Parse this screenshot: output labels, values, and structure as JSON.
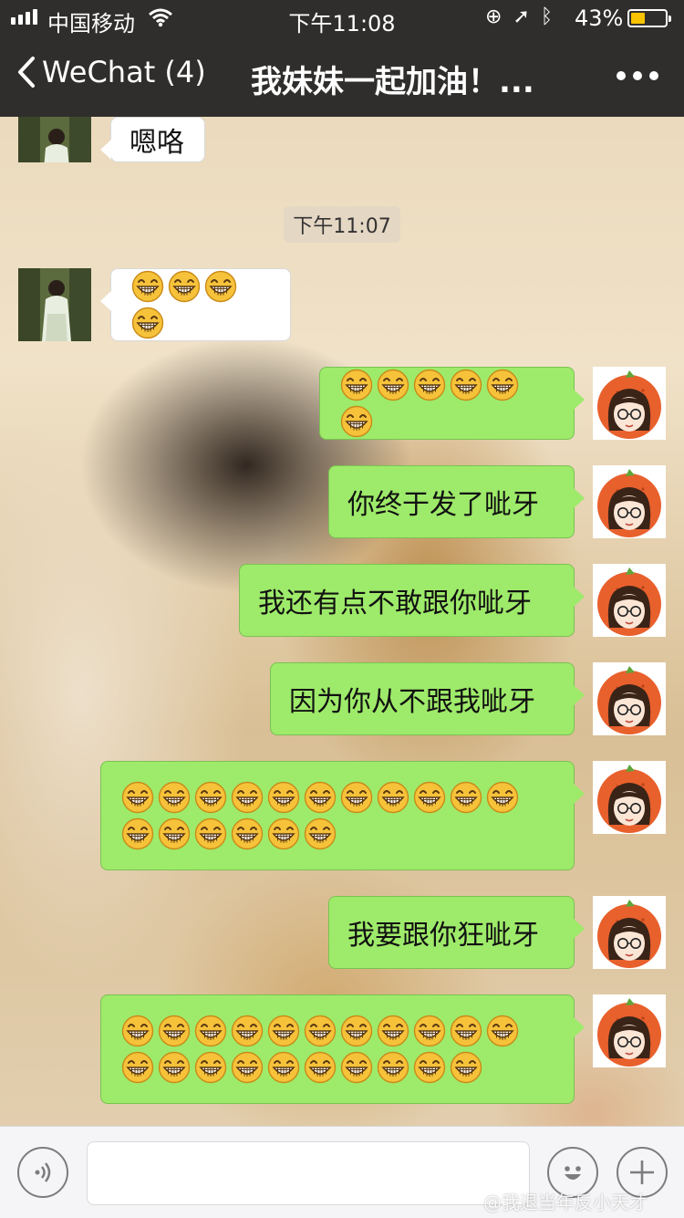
{
  "status_bar": {
    "carrier": "中国移动",
    "time": "下午11:08",
    "battery_percent": "43%",
    "battery_level": 0.43,
    "battery_color": "#f8c300"
  },
  "nav": {
    "back_label": "WeChat (4)",
    "title": "我妹妹一起加油！...",
    "more_icon": "more-dots-icon"
  },
  "chat": {
    "time_stamp": "下午11:07",
    "messages": [
      {
        "side": "left",
        "text": "嗯咯"
      },
      {
        "side": "left",
        "emoji": "grin-emoji",
        "emoji_count": 4
      },
      {
        "side": "right",
        "emoji": "grin-emoji",
        "emoji_count": 6
      },
      {
        "side": "right",
        "text": "你终于发了呲牙"
      },
      {
        "side": "right",
        "text": "我还有点不敢跟你呲牙"
      },
      {
        "side": "right",
        "text": "因为你从不跟我呲牙"
      },
      {
        "side": "right",
        "emoji": "grin-emoji",
        "emoji_count": 17
      },
      {
        "side": "right",
        "text": "我要跟你狂呲牙"
      },
      {
        "side": "right",
        "emoji": "grin-emoji",
        "emoji_count": 21
      }
    ]
  },
  "input_bar": {
    "voice_icon": "voice-icon",
    "emoji_icon": "emoji-icon",
    "plus_icon": "plus-icon",
    "value": ""
  },
  "watermark": "@我退当年反小天才",
  "colors": {
    "bubble_green": "#9eea6a",
    "nav_bg": "#2f2e2c",
    "avatar_orange": "#e8602c"
  }
}
